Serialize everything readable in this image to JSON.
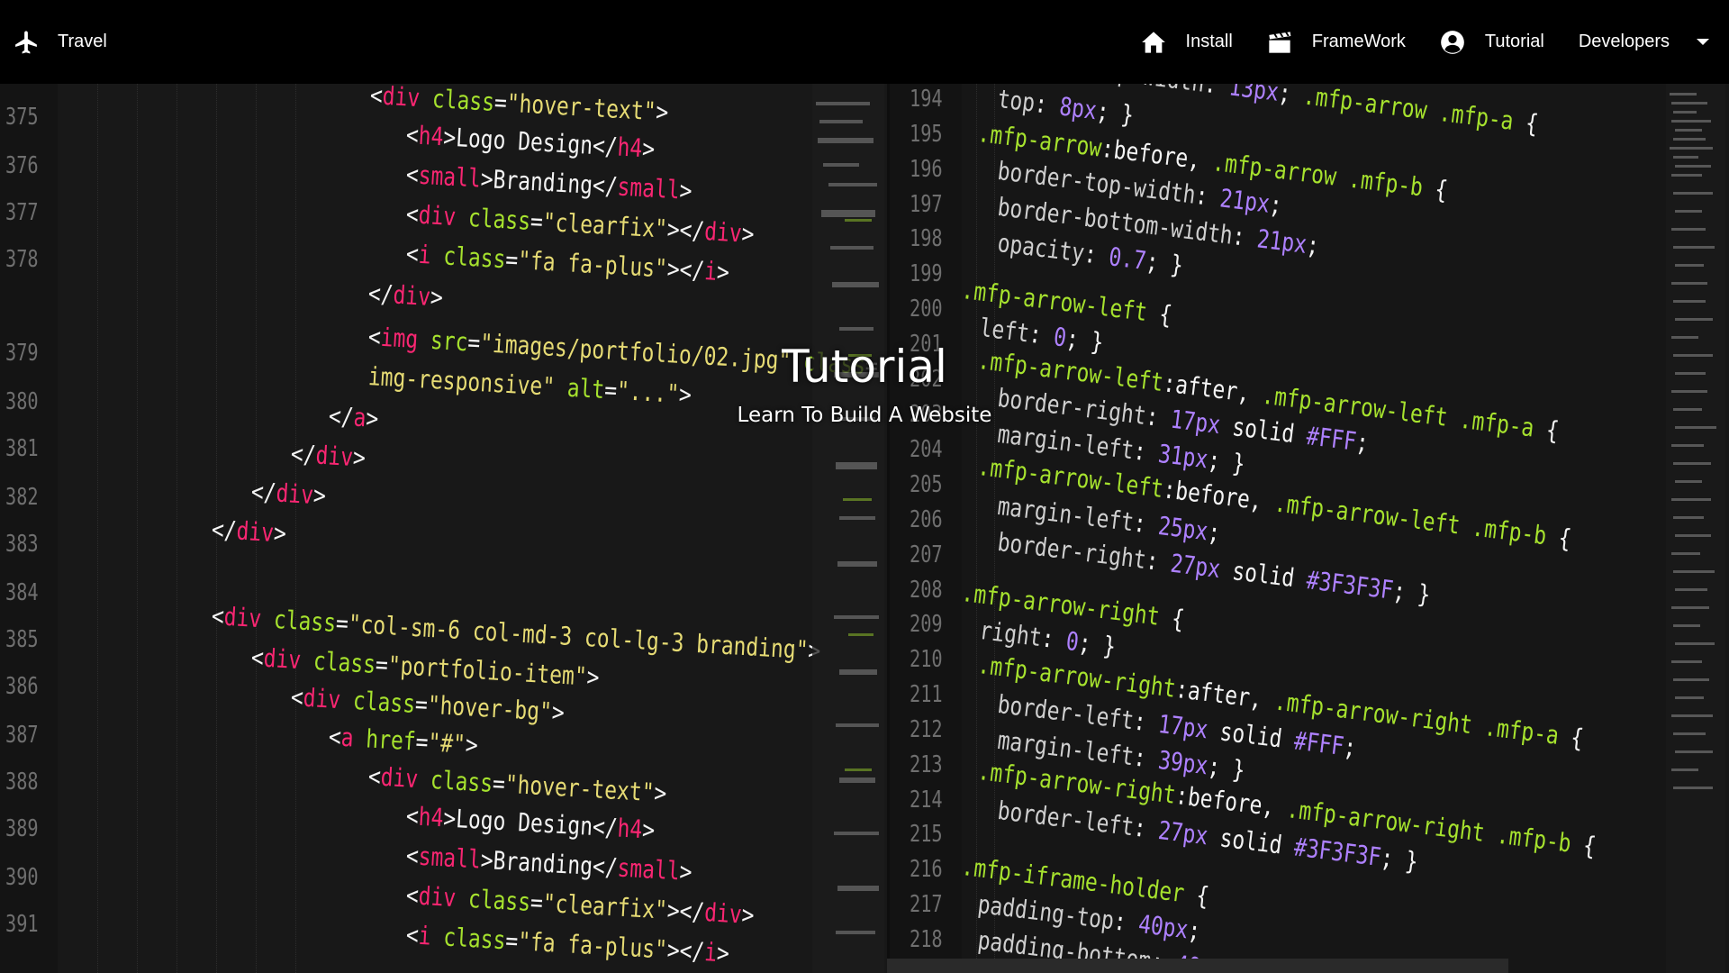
{
  "navbar": {
    "brand_label": "Travel",
    "items": [
      {
        "label": "Install",
        "icon": "home-icon"
      },
      {
        "label": "FrameWork",
        "icon": "clapperboard-icon"
      },
      {
        "label": "Tutorial",
        "icon": "user-circle-icon"
      },
      {
        "label": "Developers",
        "icon": "caret-down-icon"
      }
    ]
  },
  "hero": {
    "title": "Tutorial",
    "subtitle": "Learn To Build A Website"
  },
  "code_left": {
    "line_numbers": [
      "375",
      "376",
      "377",
      "378",
      "379",
      "380",
      "381",
      "382",
      "383",
      "384",
      "385",
      "386",
      "387",
      "388",
      "389",
      "390",
      "391"
    ]
  },
  "code_right": {
    "line_numbers": [
      "194",
      "195",
      "196",
      "197",
      "198",
      "199",
      "200",
      "201",
      "202",
      "203",
      "204",
      "205",
      "206",
      "207",
      "208",
      "209",
      "210",
      "211",
      "212",
      "213",
      "214",
      "215",
      "216",
      "217",
      "218"
    ]
  },
  "colors": {
    "navbar_bg": "#000000",
    "editor_bg": "#181818",
    "tag": "#f92672",
    "attribute": "#a6e22e",
    "string": "#e6db74",
    "number": "#ae81ff"
  }
}
